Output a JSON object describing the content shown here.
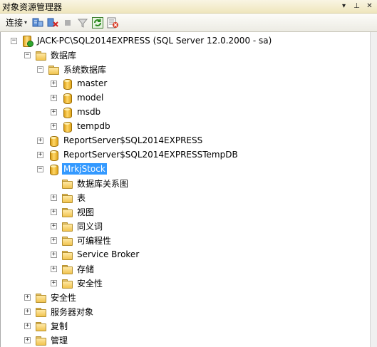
{
  "window": {
    "title": "对象资源管理器"
  },
  "title_buttons": {
    "dropdown": "▾",
    "pin": "⊥",
    "close": "✕"
  },
  "toolbar": {
    "connect_label": "连接",
    "connect_arrow": "▾"
  },
  "tree": {
    "server": {
      "label": "JACK-PC\\SQL2014EXPRESS (SQL Server 12.0.2000 - sa)",
      "toggle": "−"
    },
    "databases": {
      "label": "数据库",
      "toggle": "−"
    },
    "system_databases": {
      "label": "系统数据库",
      "toggle": "−"
    },
    "master": {
      "label": "master",
      "toggle": "+"
    },
    "model": {
      "label": "model",
      "toggle": "+"
    },
    "msdb": {
      "label": "msdb",
      "toggle": "+"
    },
    "tempdb": {
      "label": "tempdb",
      "toggle": "+"
    },
    "report_server": {
      "label": "ReportServer$SQL2014EXPRESS",
      "toggle": "+"
    },
    "report_server_temp": {
      "label": "ReportServer$SQL2014EXPRESSTempDB",
      "toggle": "+"
    },
    "mrkjstock": {
      "label": "MrkjStock",
      "toggle": "−"
    },
    "diagrams": {
      "label": "数据库关系图"
    },
    "tables": {
      "label": "表",
      "toggle": "+"
    },
    "views": {
      "label": "视图",
      "toggle": "+"
    },
    "synonyms": {
      "label": "同义词",
      "toggle": "+"
    },
    "programmability": {
      "label": "可编程性",
      "toggle": "+"
    },
    "service_broker": {
      "label": "Service Broker",
      "toggle": "+"
    },
    "storage": {
      "label": "存储",
      "toggle": "+"
    },
    "db_security": {
      "label": "安全性",
      "toggle": "+"
    },
    "security": {
      "label": "安全性",
      "toggle": "+"
    },
    "server_objects": {
      "label": "服务器对象",
      "toggle": "+"
    },
    "replication": {
      "label": "复制",
      "toggle": "+"
    },
    "management": {
      "label": "管理",
      "toggle": "+"
    }
  }
}
